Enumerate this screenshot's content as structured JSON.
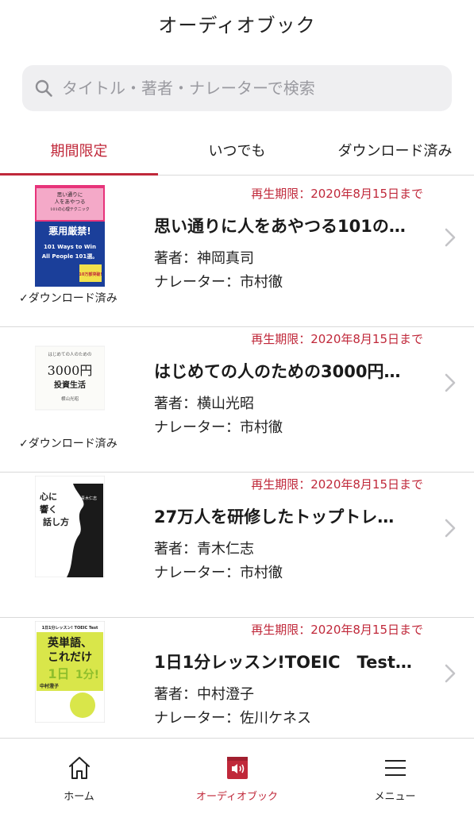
{
  "header": {
    "title": "オーディオブック"
  },
  "search": {
    "placeholder": "タイトル・著者・ナレーターで検索"
  },
  "tabs": [
    {
      "label": "期間限定"
    },
    {
      "label": "いつでも"
    },
    {
      "label": "ダウンロード済み"
    }
  ],
  "books": [
    {
      "expiry": "再生期限：2020年8月15日まで",
      "title": "思い通りに人をあやつる101の…",
      "author": "著者：神岡真司",
      "narrator": "ナレーター：市村徹",
      "downloaded": "✓ダウンロード済み",
      "cover_text": [
        "思い通りに",
        "人をあやつる",
        "101の心理テクニック",
        "悪用厳禁!",
        "101 Ways to Win",
        "All People 101選。",
        "10万部突破!"
      ]
    },
    {
      "expiry": "再生期限：2020年8月15日まで",
      "title": "はじめての人のための3000円…",
      "author": "著者：横山光昭",
      "narrator": "ナレーター：市村徹",
      "downloaded": "✓ダウンロード済み",
      "cover_text": [
        "はじめての人のための",
        "3000円",
        "投資生活",
        "横山光昭"
      ]
    },
    {
      "expiry": "再生期限：2020年8月15日まで",
      "title": "27万人を研修したトップトレ…",
      "author": "著者：青木仁志",
      "narrator": "ナレーター：市村徹",
      "downloaded": "",
      "cover_text": [
        "心に",
        "響く",
        "話し方",
        "青木仁志"
      ]
    },
    {
      "expiry": "再生期限：2020年8月15日まで",
      "title": "1日1分レッスン!TOEIC　Test…",
      "author": "著者：中村澄子",
      "narrator": "ナレーター：佐川ケネス",
      "downloaded": "",
      "cover_text": [
        "1日1分レッスン! TOEIC Test",
        "英単語、",
        "これだけ",
        "1日",
        "1分!",
        "中村澄子"
      ]
    }
  ],
  "bottom_nav": [
    {
      "label": "ホーム",
      "icon": "home-icon"
    },
    {
      "label": "オーディオブック",
      "icon": "audiobook-icon"
    },
    {
      "label": "メニュー",
      "icon": "menu-icon"
    }
  ],
  "colors": {
    "accent": "#c0283a",
    "search_bg": "#efeff1",
    "divider": "#d9d9d9"
  }
}
